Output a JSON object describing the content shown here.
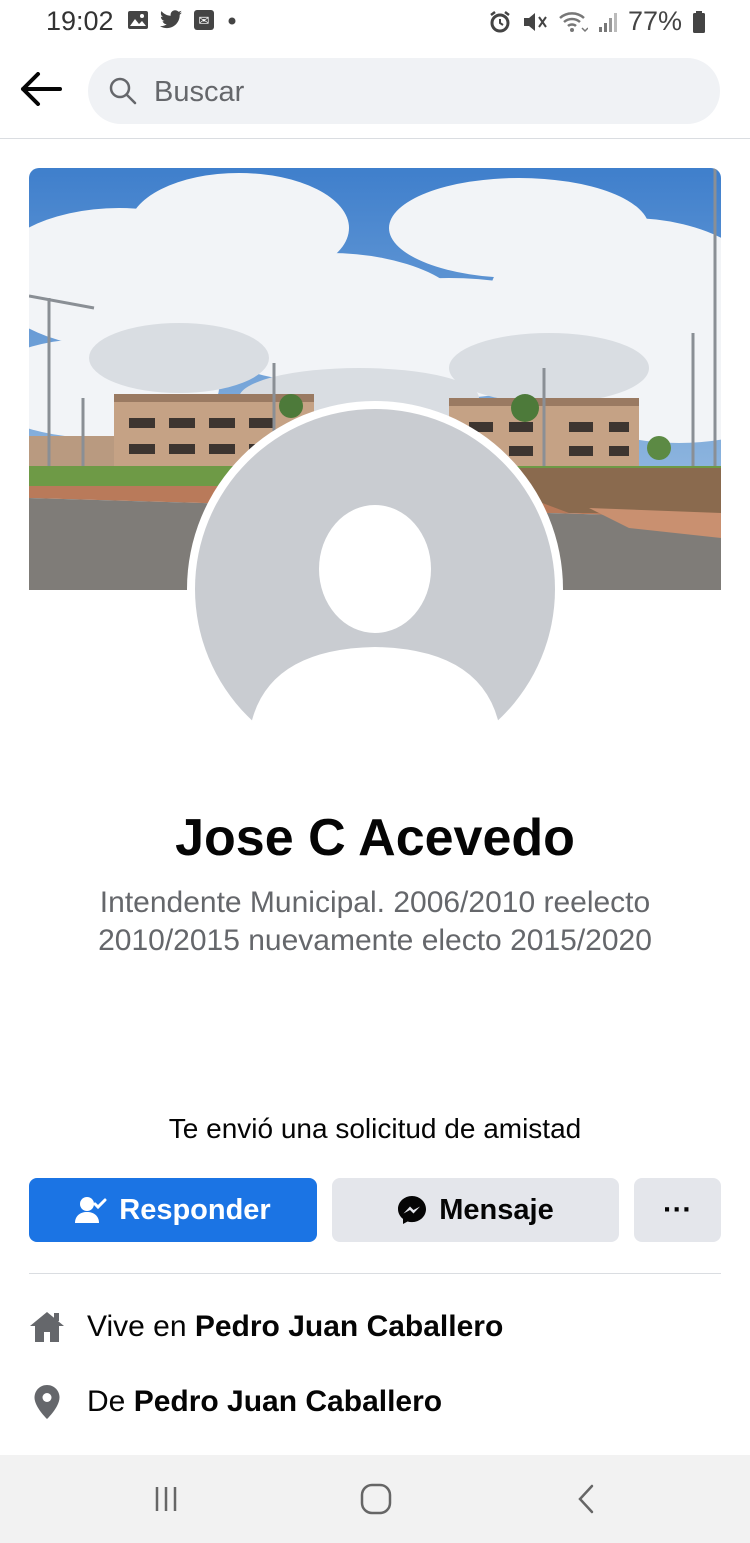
{
  "status_bar": {
    "time": "19:02",
    "battery": "77%",
    "left_icons": [
      "gallery-icon",
      "twitter-icon",
      "app-icon",
      "dot-icon"
    ],
    "right_icons": [
      "alarm-icon",
      "mute-icon",
      "wifi-icon",
      "signal-icon",
      "battery-icon"
    ]
  },
  "header": {
    "search_placeholder": "Buscar"
  },
  "profile": {
    "name": "Jose C Acevedo",
    "bio_line1": "Intendente Municipal. 2006/2010 reelecto",
    "bio_line2": "2010/2015 nuevamente electo 2015/2020"
  },
  "friend_request": {
    "text": "Te envió una solicitud de amistad"
  },
  "actions": {
    "respond_label": "Responder",
    "message_label": "Mensaje",
    "more_label": "···"
  },
  "details": {
    "lives_prefix": "Vive en ",
    "lives_city": "Pedro Juan Caballero",
    "from_prefix": "De ",
    "from_city": "Pedro Juan Caballero"
  },
  "colors": {
    "primary_button": "#1b74e4",
    "secondary_button": "#e4e6eb",
    "search_bg": "#f0f2f5",
    "secondary_text": "#65676b"
  }
}
